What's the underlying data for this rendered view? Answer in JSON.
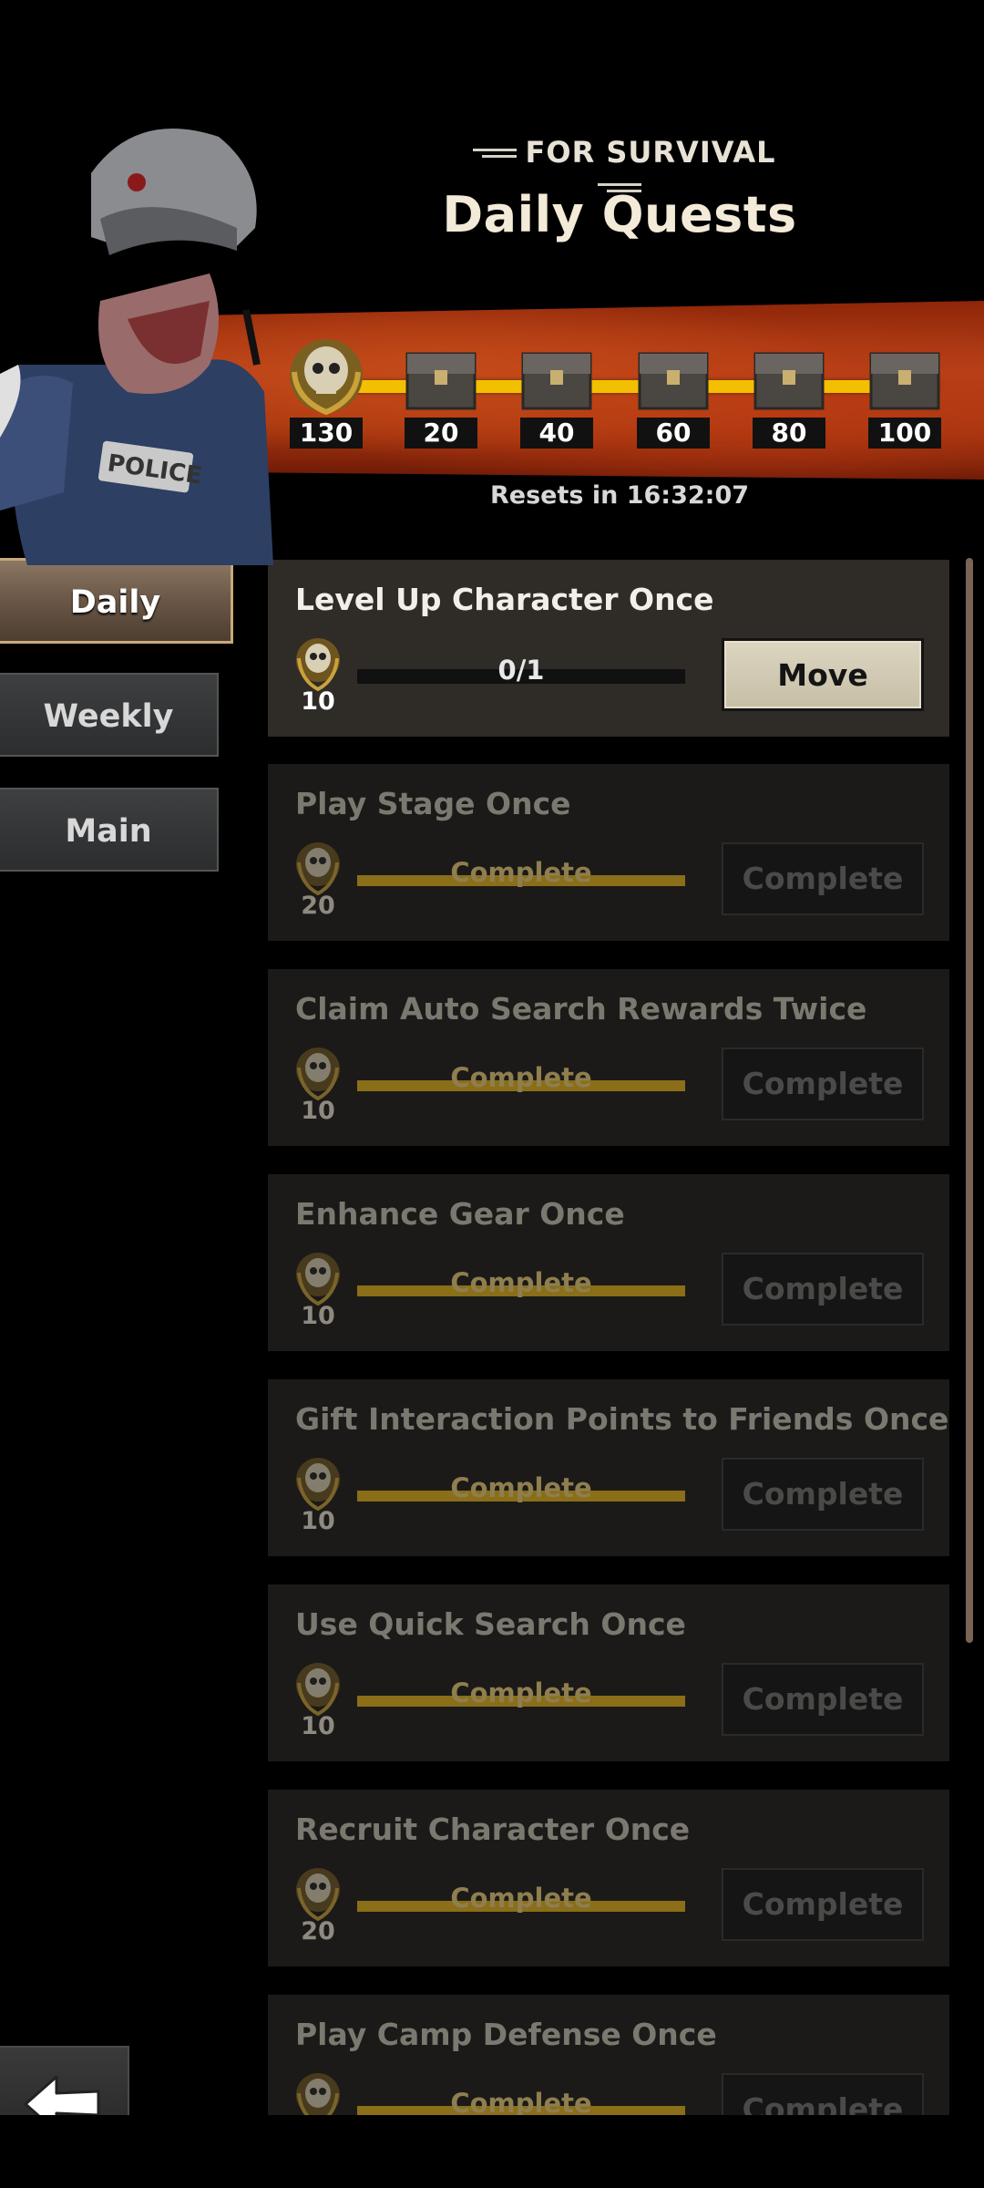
{
  "header": {
    "subtitle": "FOR SURVIVAL",
    "title": "Daily Quests",
    "resets": "Resets in 16:32:07"
  },
  "rewards": [
    {
      "icon": "skull-medal-icon",
      "value": "130"
    },
    {
      "icon": "chest-icon",
      "value": "20"
    },
    {
      "icon": "chest-icon",
      "value": "40"
    },
    {
      "icon": "chest-icon",
      "value": "60"
    },
    {
      "icon": "chest-icon",
      "value": "80"
    },
    {
      "icon": "chest-icon",
      "value": "100"
    }
  ],
  "tabs": [
    {
      "label": "Daily",
      "active": true
    },
    {
      "label": "Weekly",
      "active": false
    },
    {
      "label": "Main",
      "active": false
    }
  ],
  "quests": [
    {
      "title": "Level Up Character Once",
      "points": "10",
      "progress": "0/1",
      "button": "Move",
      "active": true
    },
    {
      "title": "Play Stage Once",
      "points": "20",
      "progress": "Complete",
      "button": "Complete",
      "active": false
    },
    {
      "title": "Claim Auto Search Rewards Twice",
      "points": "10",
      "progress": "Complete",
      "button": "Complete",
      "active": false
    },
    {
      "title": "Enhance Gear Once",
      "points": "10",
      "progress": "Complete",
      "button": "Complete",
      "active": false
    },
    {
      "title": "Gift Interaction Points to Friends Once",
      "points": "10",
      "progress": "Complete",
      "button": "Complete",
      "active": false
    },
    {
      "title": "Use Quick Search Once",
      "points": "10",
      "progress": "Complete",
      "button": "Complete",
      "active": false
    },
    {
      "title": "Recruit Character Once",
      "points": "20",
      "progress": "Complete",
      "button": "Complete",
      "active": false
    },
    {
      "title": "Play Camp Defense Once",
      "points": "",
      "progress": "Complete",
      "button": "Complete",
      "active": false
    }
  ],
  "colors": {
    "accent_yellow": "#f2c000",
    "banner_red": "#b8421a",
    "panel_active": "#2f2b27",
    "panel_done": "#1b1a18"
  }
}
